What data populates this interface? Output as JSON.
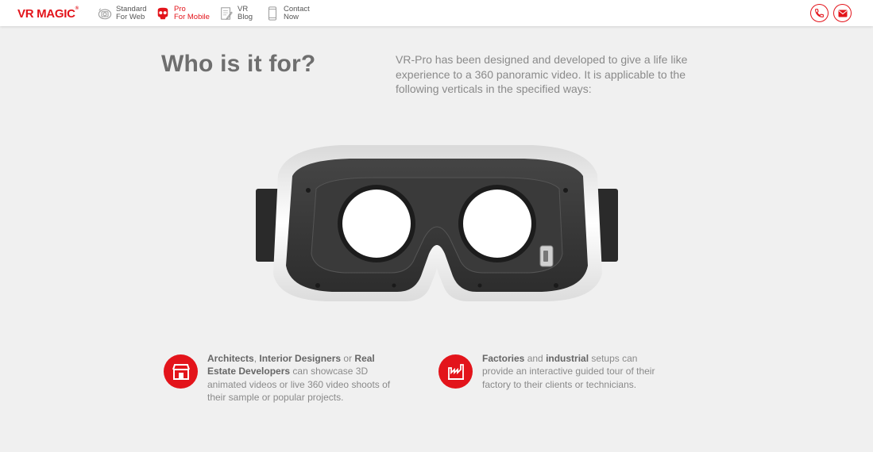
{
  "header": {
    "logo_text": "VR MAGIC",
    "logo_mark": "®",
    "nav": [
      {
        "line1": "Standard",
        "line2": "For Web",
        "icon": "camera-360-icon",
        "active": false
      },
      {
        "line1": "Pro",
        "line2": "For Mobile",
        "icon": "vr-headset-icon",
        "active": true
      },
      {
        "line1": "VR",
        "line2": "Blog",
        "icon": "document-pencil-icon",
        "active": false
      },
      {
        "line1": "Contact",
        "line2": "Now",
        "icon": "mobile-phone-icon",
        "active": false
      }
    ],
    "actions": [
      {
        "icon": "phone-icon"
      },
      {
        "icon": "mail-icon"
      }
    ]
  },
  "main": {
    "title": "Who is it for?",
    "intro": "VR-Pro has been designed and developed to give a life like experience to a 360 panoramic video. It is applicable to the following verticals in the specified ways:"
  },
  "features": [
    {
      "icon": "storefront-icon",
      "b1": "Architects",
      "t1": ", ",
      "b2": "Interior Designers",
      "t2": " or ",
      "b3": "Real Estate Developers",
      "t3": " can showcase 3D animated videos or live 360 video shoots of their sample or popular projects."
    },
    {
      "icon": "factory-icon",
      "b1": "Factories",
      "t1": " and ",
      "b2": "industrial",
      "t2": " setups can provide an interactive guided tour of their factory to their clients or technicians."
    }
  ],
  "colors": {
    "accent": "#e3141b",
    "background": "#f0f0f0",
    "heading": "#6e6e6e",
    "body_text": "#8a8a8a"
  }
}
